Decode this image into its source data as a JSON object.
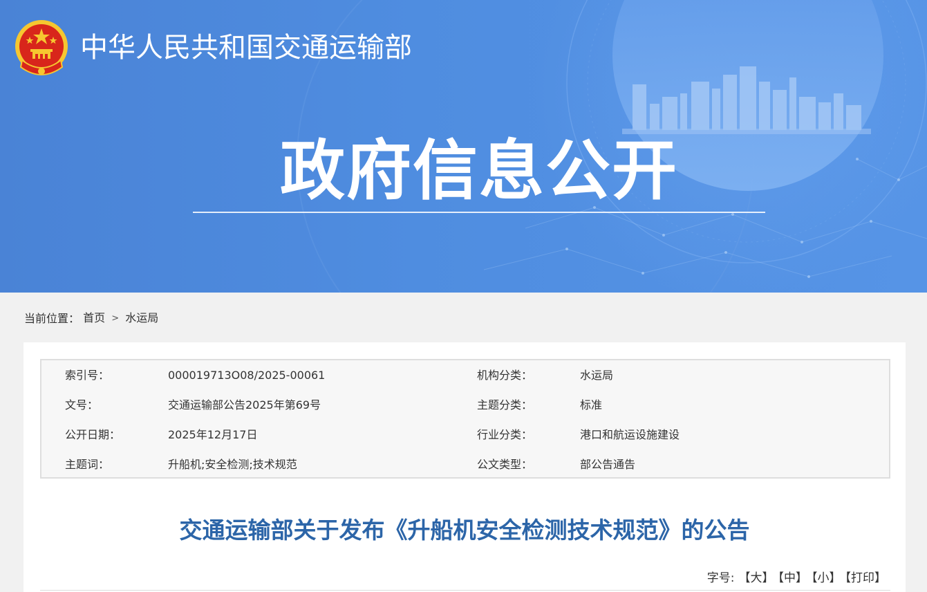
{
  "header": {
    "ministry_name": "中华人民共和国交通运输部",
    "banner_title": "政府信息公开",
    "colors": {
      "banner_blue": "#4f8de0",
      "emblem_red": "#d8261b",
      "emblem_gold": "#f6c730"
    }
  },
  "breadcrumb": {
    "label": "当前位置：",
    "items": [
      "首页",
      "水运局"
    ],
    "separator": ">"
  },
  "meta": {
    "rows": [
      {
        "label1": "索引号：",
        "value1": "000019713O08/2025-00061",
        "label2": "机构分类：",
        "value2": "水运局"
      },
      {
        "label1": "文号：",
        "value1": "交通运输部公告2025年第69号",
        "label2": "主题分类：",
        "value2": "标准"
      },
      {
        "label1": "公开日期：",
        "value1": "2025年12月17日",
        "label2": "行业分类：",
        "value2": "港口和航运设施建设"
      },
      {
        "label1": "主题词：",
        "value1": "升船机;安全检测;技术规范",
        "label2": "公文类型：",
        "value2": "部公告通告"
      }
    ]
  },
  "article": {
    "title": "交通运输部关于发布《升船机安全检测技术规范》的公告",
    "title_color": "#2c65a8"
  },
  "font_controls": {
    "label": "字号:",
    "large": "【大】",
    "medium": "【中】",
    "small": "【小】",
    "print": "【打印】"
  }
}
